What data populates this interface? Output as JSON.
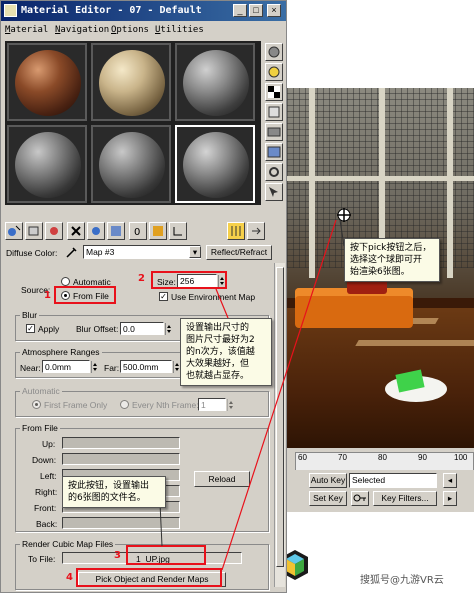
{
  "window": {
    "title": "Material Editor - 07 - Default",
    "menus": [
      "Material",
      "Navigation",
      "Options",
      "Utilities"
    ]
  },
  "params": {
    "diffuse_label": "Diffuse Color:",
    "map_name": "Map #3",
    "reflect_button": "Reflect/Refract",
    "source_label": "Source:",
    "automatic_label": "Automatic",
    "from_file_label": "From File",
    "size_label": "Size:",
    "size_value": "256",
    "env_map_label": "Use Environment Map",
    "blur_group": "Blur",
    "apply_label": "Apply",
    "blur_offset_label": "Blur Offset:",
    "blur_offset_value": "0.0",
    "atmo_group": "Atmosphere Ranges",
    "near_label": "Near:",
    "near_value": "0.0mm",
    "far_label": "Far:",
    "far_value": "500.0mm",
    "automatic_group": "Automatic",
    "first_frame_label": "First Frame Only",
    "every_nth_label": "Every Nth Frame:",
    "every_nth_value": "1",
    "from_file_group": "From File",
    "from_file_slots": [
      "Up:",
      "Down:",
      "Left:",
      "Right:",
      "Front:",
      "Back:"
    ],
    "reload_button": "Reload",
    "render_group": "Render Cubic Map Files",
    "to_file_label": "To File:",
    "to_file_value": "1_UP.jpg",
    "pick_button": "Pick Object and Render Maps"
  },
  "annotations": {
    "n1": "1",
    "n2": "2",
    "n3": "3",
    "n4": "4",
    "callout_size": "设置输出尺寸的\n图片尺寸最好为2\n的n次方，该值越\n大效果越好，但\n也就越占显存。",
    "callout_pick": "按下pick按钮之后，\n选择这个球即可开\n始渲染6张图。",
    "callout_file": "按此按钮，设置输出\n的6张图的文件名。"
  },
  "timeline": {
    "ticks": [
      "60",
      "70",
      "80",
      "90",
      "100"
    ],
    "auto_key": "Auto Key",
    "selected": "Selected",
    "set_key": "Set Key",
    "key_filters": "Key Filters..."
  },
  "watermark": "搜狐号@九游VR云",
  "colors": {
    "annotation_red": "#e8111b",
    "title_bar": "#0a246a",
    "active_tool": "#f6d04a"
  }
}
